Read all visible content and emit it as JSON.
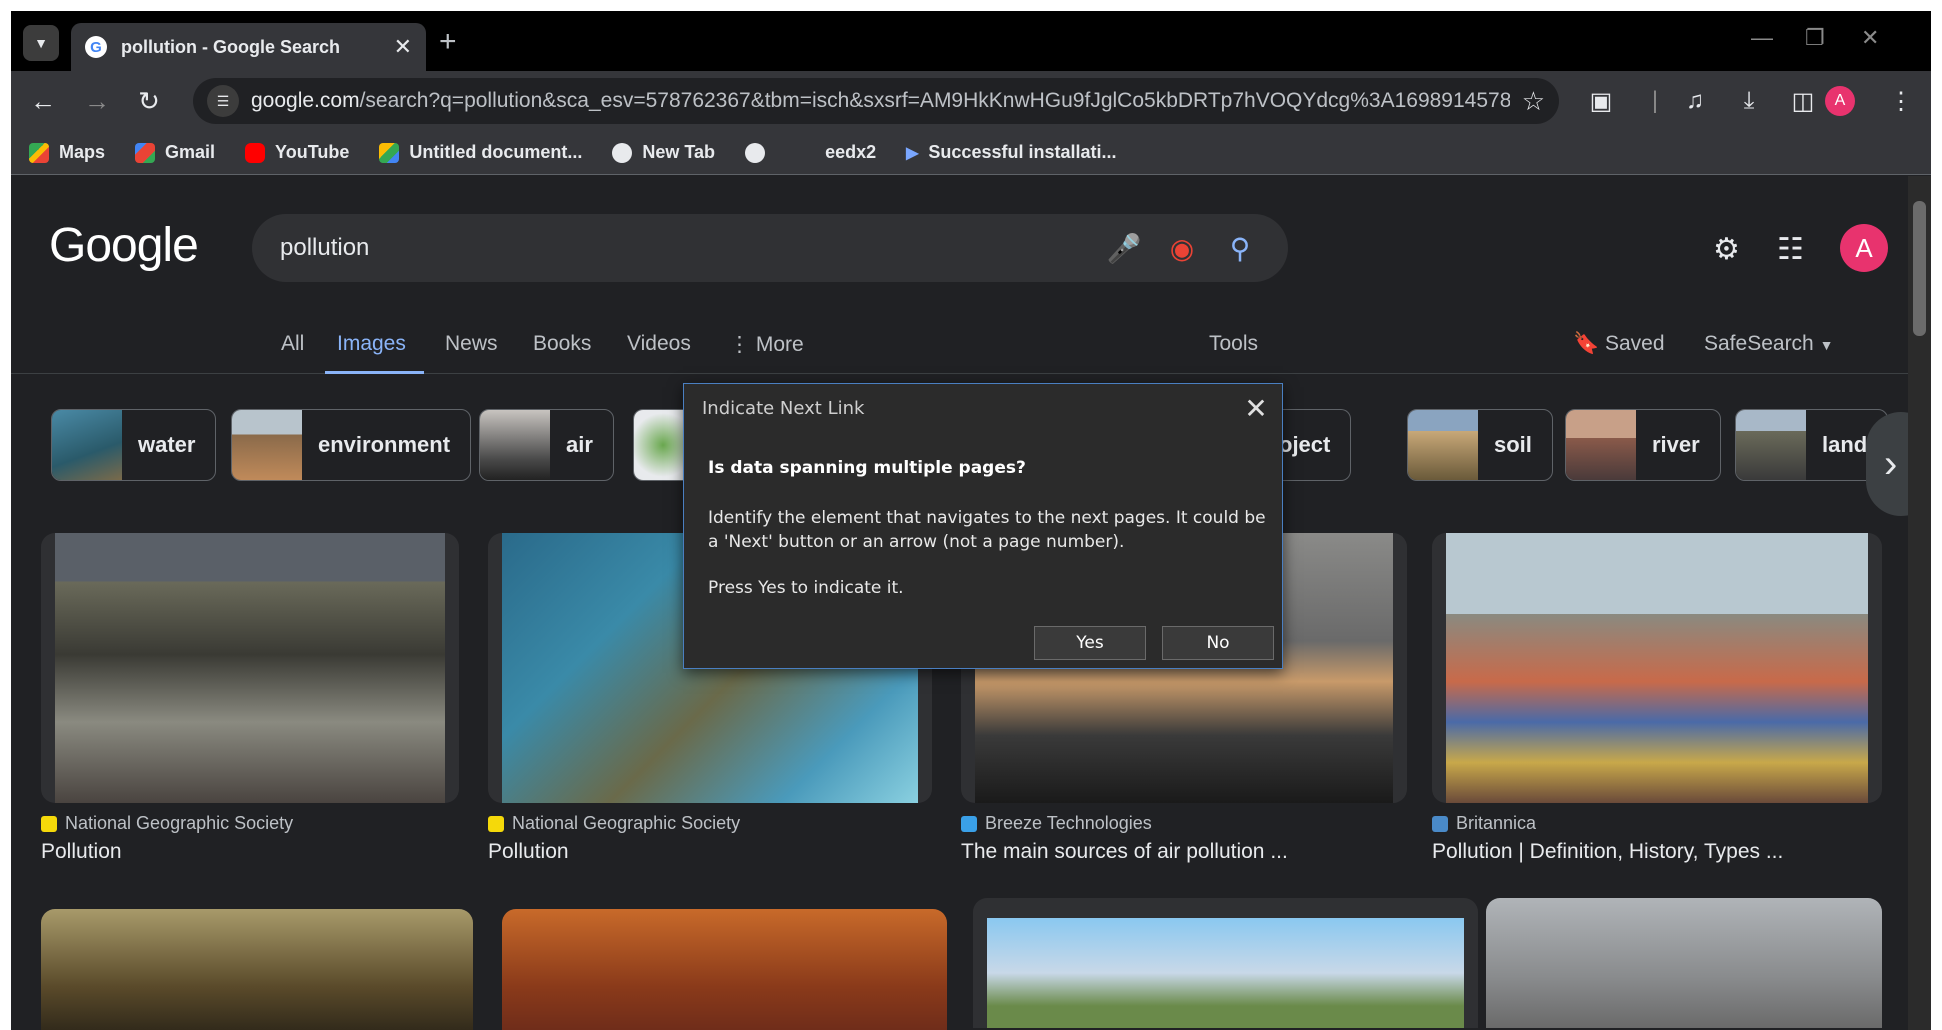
{
  "browser": {
    "tab_title": "pollution - Google Search",
    "url_host": "google.com",
    "url_rest": "/search?q=pollution&sca_esv=578762367&tbm=isch&sxsrf=AM9HkKnwHGu9fJglCo5kbDRTp7hVOQYdcg%3A1698914578...",
    "profile_initial": "A",
    "bookmarks": [
      {
        "label": "Maps",
        "icon": "maps-icon",
        "color": "#34a853"
      },
      {
        "label": "Gmail",
        "icon": "gmail-icon",
        "color": "#ea4335"
      },
      {
        "label": "YouTube",
        "icon": "youtube-icon",
        "color": "#ff0000"
      },
      {
        "label": "Untitled document...",
        "icon": "drive-icon",
        "color": "#fbbc04"
      },
      {
        "label": "New Tab",
        "icon": "globe-icon",
        "color": "#e8eaed"
      },
      {
        "label": "",
        "icon": "globe-icon",
        "color": "#e8eaed"
      },
      {
        "label": "eedx2",
        "icon": "",
        "color": ""
      },
      {
        "label": "Successful installati...",
        "icon": "play-icon",
        "color": "#7aa7ff"
      }
    ]
  },
  "google": {
    "logo": "Google",
    "query": "pollution",
    "avatar_initial": "A",
    "tabs": [
      "All",
      "Images",
      "News",
      "Books",
      "Videos",
      "More"
    ],
    "active_tab": "Images",
    "tools": "Tools",
    "saved": "Saved",
    "safesearch": "SafeSearch",
    "chips": [
      "water",
      "environment",
      "air",
      "",
      "project",
      "soil",
      "river",
      "land"
    ],
    "results": [
      {
        "source": "National Geographic Society",
        "title": "Pollution"
      },
      {
        "source": "National Geographic Society",
        "title": "Pollution"
      },
      {
        "source": "Breeze Technologies",
        "title": "The main sources of air pollution ..."
      },
      {
        "source": "Britannica",
        "title": "Pollution | Definition, History, Types ..."
      }
    ]
  },
  "dialog": {
    "title": "Indicate Next Link",
    "heading": "Is data spanning multiple pages?",
    "body": "Identify the element that navigates to the next pages. It could be a 'Next' button or an arrow (not a page number).",
    "prompt": "Press Yes to indicate it.",
    "yes": "Yes",
    "no": "No"
  },
  "colors": {
    "accent": "#8ab4f8",
    "avatar": "#e8336e",
    "dialog_border": "#4a7fc1"
  }
}
